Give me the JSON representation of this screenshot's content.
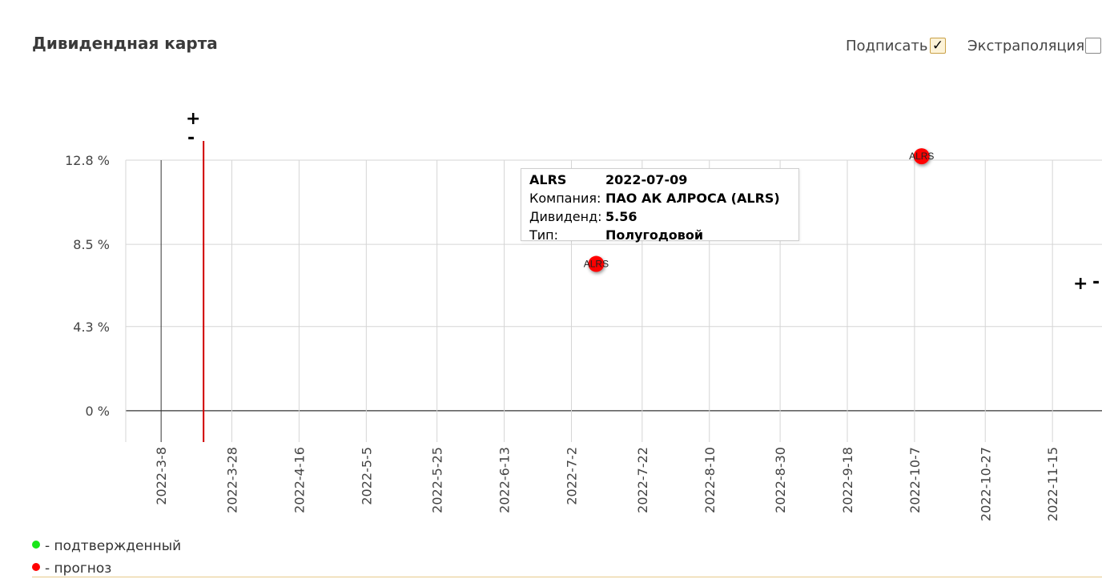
{
  "title": "Дивидендная карта",
  "controls": {
    "sign_label": "Подписать",
    "sign_checked": true,
    "extrapolation_label": "Экстраполяция",
    "extrapolation_checked": false
  },
  "zoom": {
    "plus": "+",
    "minus": "-"
  },
  "chart_data": {
    "type": "scatter",
    "title": "",
    "xlabel": "",
    "ylabel": "",
    "x_ticks": [
      "2022-3-8",
      "2022-3-28",
      "2022-4-16",
      "2022-5-5",
      "2022-5-25",
      "2022-6-13",
      "2022-7-2",
      "2022-7-22",
      "2022-8-10",
      "2022-8-30",
      "2022-9-18",
      "2022-10-7",
      "2022-10-27",
      "2022-11-15"
    ],
    "y_ticks": [
      "0 %",
      "4.3 %",
      "8.5 %",
      "12.8 %"
    ],
    "y_tick_values": [
      0,
      4.3,
      8.5,
      12.8
    ],
    "xlim": [
      "2022-02-26",
      "2022-11-29"
    ],
    "ylim": [
      -1.6,
      12.8
    ],
    "today_marker": "2022-03-20",
    "today_color": "#d00000",
    "grid": true,
    "series": [
      {
        "color": "#ff0000",
        "points": [
          {
            "x": "2022-07-09",
            "y": 7.5,
            "label": "ALRS"
          },
          {
            "x": "2022-10-09",
            "y": 13.0,
            "label": "ALRS"
          }
        ]
      }
    ]
  },
  "tooltip": {
    "ticker": "ALRS",
    "date": "2022-07-09",
    "company_label": "Компания:",
    "company_value": "ПАО АК АЛРОСА (ALRS)",
    "dividend_label": "Дивиденд:",
    "dividend_value": "5.56",
    "type_label": "Тип:",
    "type_value": "Полугодовой"
  },
  "legend": [
    {
      "label": "- подтвержденный",
      "color": "#19e619"
    },
    {
      "label": "- прогноз",
      "color": "#ff0000"
    }
  ]
}
